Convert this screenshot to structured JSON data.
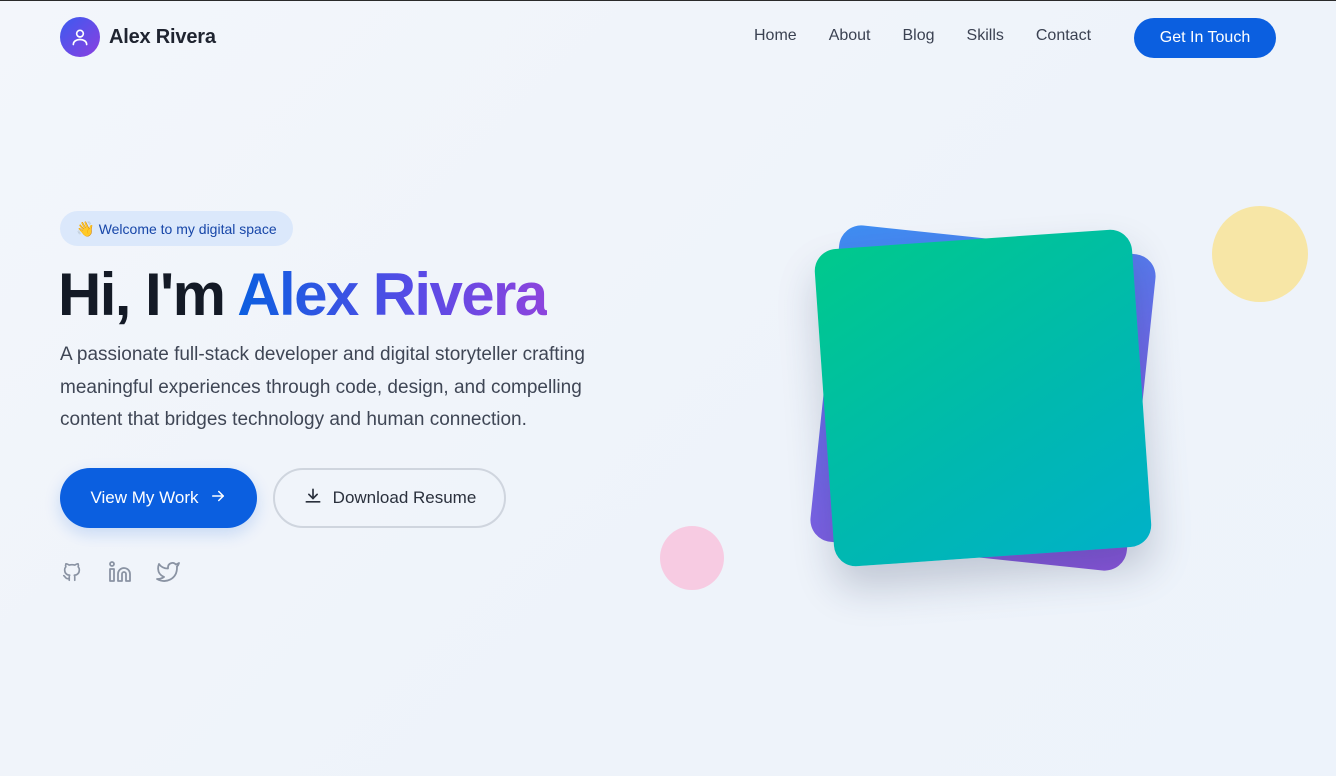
{
  "header": {
    "brand_name": "Alex Rivera",
    "nav": [
      {
        "label": "Home"
      },
      {
        "label": "About"
      },
      {
        "label": "Blog"
      },
      {
        "label": "Skills"
      },
      {
        "label": "Contact"
      }
    ],
    "cta_label": "Get In Touch"
  },
  "hero": {
    "badge_emoji": "👋",
    "badge_text": "Welcome to my digital space",
    "title_prefix": "Hi, I'm ",
    "title_name": "Alex Rivera",
    "description": "A passionate full-stack developer and digital storyteller crafting meaningful experiences through code, design, and compelling content that bridges technology and human connection.",
    "primary_button": "View My Work",
    "secondary_button": "Download Resume"
  },
  "socials": [
    {
      "icon": "github-icon"
    },
    {
      "icon": "linkedin-icon"
    },
    {
      "icon": "twitter-icon"
    }
  ],
  "colors": {
    "accent": "#0b5fe0",
    "purple": "#8d44dd",
    "teal": "#00b8b0",
    "yellow": "#f7e6a6",
    "pink": "#f7cbe2"
  }
}
